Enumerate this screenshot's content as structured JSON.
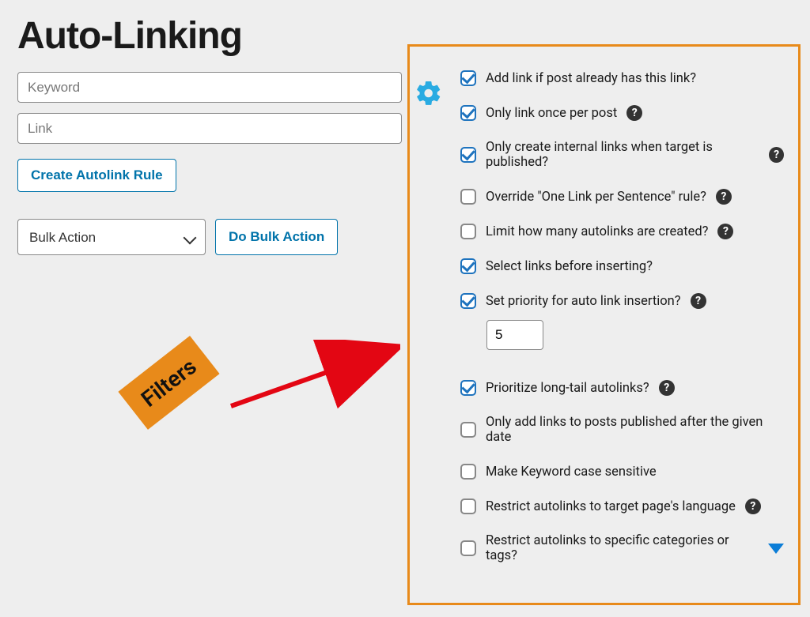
{
  "page": {
    "title": "Auto-Linking"
  },
  "inputs": {
    "keyword_placeholder": "Keyword",
    "link_placeholder": "Link"
  },
  "buttons": {
    "create_rule": "Create Autolink Rule",
    "do_bulk": "Do Bulk Action"
  },
  "bulk_select": {
    "label": "Bulk Action"
  },
  "priority_value": "5",
  "annotation": {
    "filters_label": "Filters"
  },
  "settings": {
    "add_if_exists": {
      "label": "Add link if post already has this link?",
      "checked": true,
      "help": false
    },
    "once_per_post": {
      "label": "Only link once per post",
      "checked": true,
      "help": true
    },
    "internal_pub": {
      "label": "Only create internal links when target is published?",
      "checked": true,
      "help": true
    },
    "override_one": {
      "label": "Override \"One Link per Sentence\" rule?",
      "checked": false,
      "help": true
    },
    "limit_count": {
      "label": "Limit how many autolinks are created?",
      "checked": false,
      "help": true
    },
    "select_before": {
      "label": "Select links before inserting?",
      "checked": true,
      "help": false
    },
    "set_priority": {
      "label": "Set priority for auto link insertion?",
      "checked": true,
      "help": true
    },
    "prioritize_long": {
      "label": "Prioritize long-tail autolinks?",
      "checked": true,
      "help": true
    },
    "after_date": {
      "label": "Only add links to posts published after the given date",
      "checked": false,
      "help": false
    },
    "case_sensitive": {
      "label": "Make Keyword case sensitive",
      "checked": false,
      "help": false
    },
    "restrict_lang": {
      "label": "Restrict autolinks to target page's language",
      "checked": false,
      "help": true
    },
    "restrict_cat": {
      "label": "Restrict autolinks to specific categories or tags?",
      "checked": false,
      "help": false,
      "expander": true
    }
  }
}
